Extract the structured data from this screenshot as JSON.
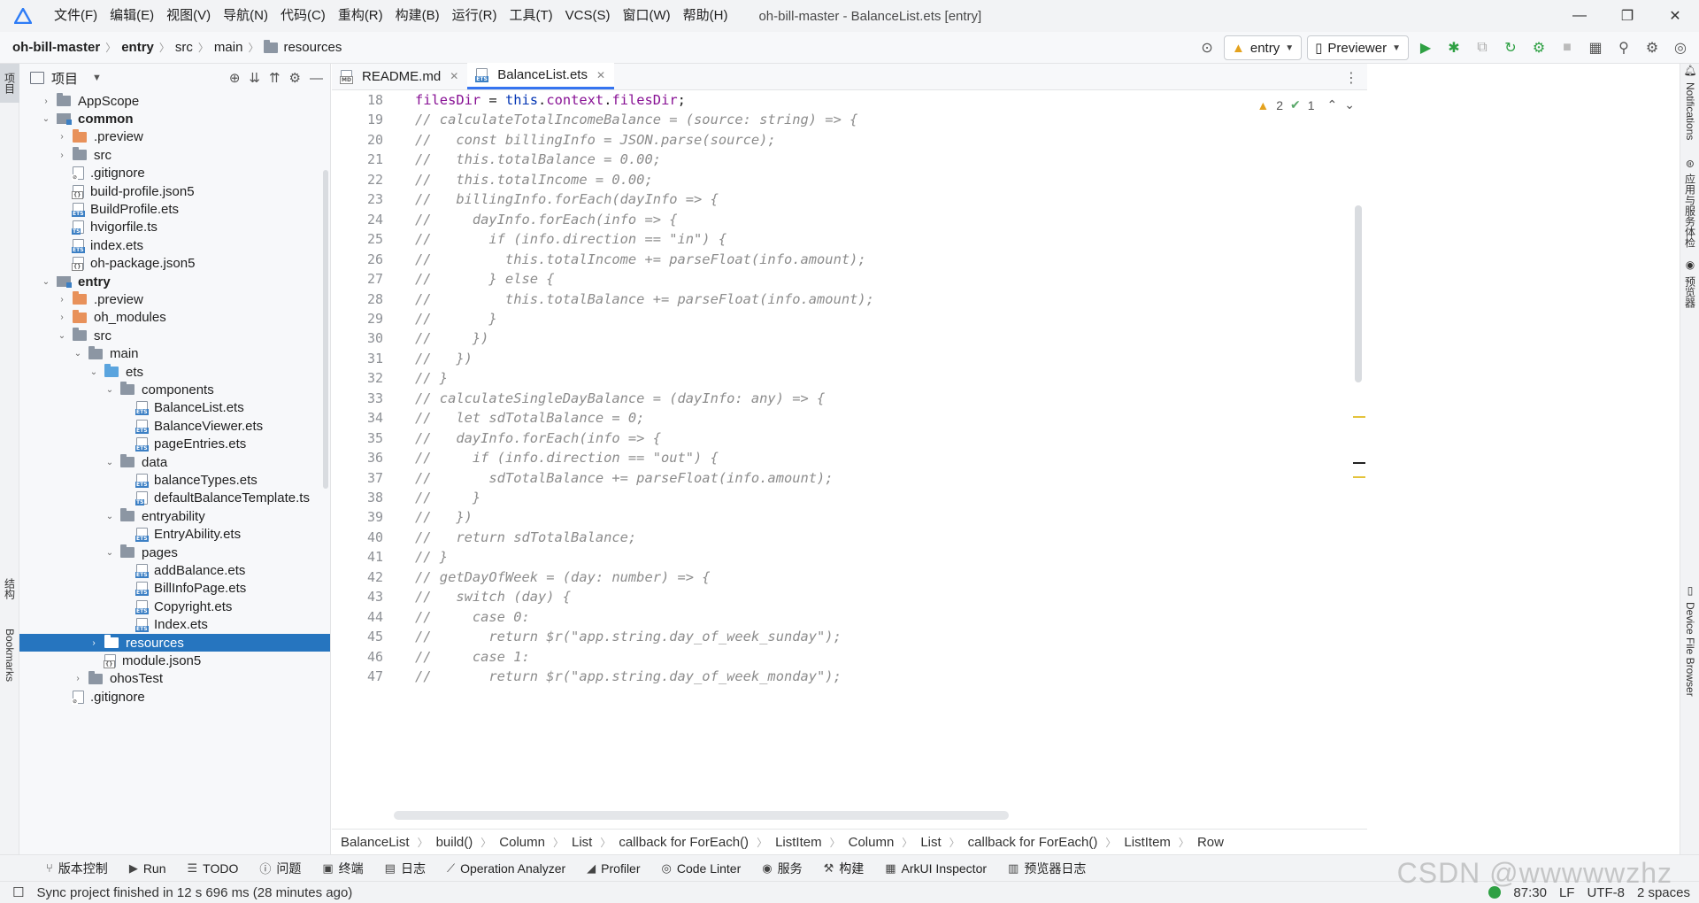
{
  "menubar": {
    "items": [
      "文件(F)",
      "编辑(E)",
      "视图(V)",
      "导航(N)",
      "代码(C)",
      "重构(R)",
      "构建(B)",
      "运行(R)",
      "工具(T)",
      "VCS(S)",
      "窗口(W)",
      "帮助(H)"
    ],
    "window_title": "oh-bill-master - BalanceList.ets [entry]"
  },
  "navbar": {
    "crumbs": [
      "oh-bill-master",
      "entry",
      "src",
      "main",
      "resources"
    ],
    "run_config": "entry",
    "device": "Previewer"
  },
  "left_stripe": {
    "project_tab": "项目",
    "structure_tab": "结构",
    "bookmarks_tab": "Bookmarks"
  },
  "project_panel": {
    "title": "项目",
    "tree": [
      {
        "label": "AppScope",
        "depth": 0,
        "arrow": "›",
        "icon": "folder",
        "bold": false
      },
      {
        "label": "common",
        "depth": 0,
        "arrow": "⌄",
        "icon": "module",
        "bold": true
      },
      {
        "label": ".preview",
        "depth": 1,
        "arrow": "›",
        "icon": "folder-orange",
        "bold": false
      },
      {
        "label": "src",
        "depth": 1,
        "arrow": "›",
        "icon": "folder",
        "bold": false
      },
      {
        "label": ".gitignore",
        "depth": 1,
        "arrow": "",
        "icon": "file-git",
        "bold": false
      },
      {
        "label": "build-profile.json5",
        "depth": 1,
        "arrow": "",
        "icon": "file-json",
        "bold": false
      },
      {
        "label": "BuildProfile.ets",
        "depth": 1,
        "arrow": "",
        "icon": "file-ets",
        "bold": false
      },
      {
        "label": "hvigorfile.ts",
        "depth": 1,
        "arrow": "",
        "icon": "file-ts",
        "bold": false
      },
      {
        "label": "index.ets",
        "depth": 1,
        "arrow": "",
        "icon": "file-ets",
        "bold": false
      },
      {
        "label": "oh-package.json5",
        "depth": 1,
        "arrow": "",
        "icon": "file-json",
        "bold": false
      },
      {
        "label": "entry",
        "depth": 0,
        "arrow": "⌄",
        "icon": "module",
        "bold": true
      },
      {
        "label": ".preview",
        "depth": 1,
        "arrow": "›",
        "icon": "folder-orange",
        "bold": false
      },
      {
        "label": "oh_modules",
        "depth": 1,
        "arrow": "›",
        "icon": "folder-orange",
        "bold": false
      },
      {
        "label": "src",
        "depth": 1,
        "arrow": "⌄",
        "icon": "folder",
        "bold": false
      },
      {
        "label": "main",
        "depth": 2,
        "arrow": "⌄",
        "icon": "folder",
        "bold": false
      },
      {
        "label": "ets",
        "depth": 3,
        "arrow": "⌄",
        "icon": "folder-blue",
        "bold": false
      },
      {
        "label": "components",
        "depth": 4,
        "arrow": "⌄",
        "icon": "folder",
        "bold": false
      },
      {
        "label": "BalanceList.ets",
        "depth": 5,
        "arrow": "",
        "icon": "file-ets",
        "bold": false
      },
      {
        "label": "BalanceViewer.ets",
        "depth": 5,
        "arrow": "",
        "icon": "file-ets",
        "bold": false
      },
      {
        "label": "pageEntries.ets",
        "depth": 5,
        "arrow": "",
        "icon": "file-ets",
        "bold": false
      },
      {
        "label": "data",
        "depth": 4,
        "arrow": "⌄",
        "icon": "folder",
        "bold": false
      },
      {
        "label": "balanceTypes.ets",
        "depth": 5,
        "arrow": "",
        "icon": "file-ets",
        "bold": false
      },
      {
        "label": "defaultBalanceTemplate.ts",
        "depth": 5,
        "arrow": "",
        "icon": "file-ts",
        "bold": false
      },
      {
        "label": "entryability",
        "depth": 4,
        "arrow": "⌄",
        "icon": "folder",
        "bold": false
      },
      {
        "label": "EntryAbility.ets",
        "depth": 5,
        "arrow": "",
        "icon": "file-ets",
        "bold": false
      },
      {
        "label": "pages",
        "depth": 4,
        "arrow": "⌄",
        "icon": "folder",
        "bold": false
      },
      {
        "label": "addBalance.ets",
        "depth": 5,
        "arrow": "",
        "icon": "file-ets",
        "bold": false
      },
      {
        "label": "BillInfoPage.ets",
        "depth": 5,
        "arrow": "",
        "icon": "file-ets",
        "bold": false
      },
      {
        "label": "Copyright.ets",
        "depth": 5,
        "arrow": "",
        "icon": "file-ets",
        "bold": false
      },
      {
        "label": "Index.ets",
        "depth": 5,
        "arrow": "",
        "icon": "file-ets",
        "bold": false
      },
      {
        "label": "resources",
        "depth": 3,
        "arrow": "›",
        "icon": "folder-white",
        "bold": false,
        "selected": true
      },
      {
        "label": "module.json5",
        "depth": 3,
        "arrow": "",
        "icon": "file-json",
        "bold": false
      },
      {
        "label": "ohosTest",
        "depth": 2,
        "arrow": "›",
        "icon": "folder",
        "bold": false
      },
      {
        "label": ".gitignore",
        "depth": 1,
        "arrow": "",
        "icon": "file-git",
        "bold": false
      }
    ]
  },
  "editor_tabs": [
    {
      "label": "README.md",
      "active": false
    },
    {
      "label": "BalanceList.ets",
      "active": true
    }
  ],
  "editor": {
    "warnings": "2",
    "checks": "1",
    "lines": [
      {
        "n": "18",
        "text": "filesDir = this.context.filesDir;",
        "comment": false
      },
      {
        "n": "19",
        "text": "// calculateTotalIncomeBalance = (source: string) => {",
        "comment": true
      },
      {
        "n": "20",
        "text": "//   const billingInfo = JSON.parse(source);",
        "comment": true
      },
      {
        "n": "21",
        "text": "//   this.totalBalance = 0.00;",
        "comment": true
      },
      {
        "n": "22",
        "text": "//   this.totalIncome = 0.00;",
        "comment": true
      },
      {
        "n": "23",
        "text": "//   billingInfo.forEach(dayInfo => {",
        "comment": true
      },
      {
        "n": "24",
        "text": "//     dayInfo.forEach(info => {",
        "comment": true
      },
      {
        "n": "25",
        "text": "//       if (info.direction == \"in\") {",
        "comment": true
      },
      {
        "n": "26",
        "text": "//         this.totalIncome += parseFloat(info.amount);",
        "comment": true
      },
      {
        "n": "27",
        "text": "//       } else {",
        "comment": true
      },
      {
        "n": "28",
        "text": "//         this.totalBalance += parseFloat(info.amount);",
        "comment": true
      },
      {
        "n": "29",
        "text": "//       }",
        "comment": true
      },
      {
        "n": "30",
        "text": "//     })",
        "comment": true
      },
      {
        "n": "31",
        "text": "//   })",
        "comment": true
      },
      {
        "n": "32",
        "text": "// }",
        "comment": true
      },
      {
        "n": "33",
        "text": "// calculateSingleDayBalance = (dayInfo: any) => {",
        "comment": true
      },
      {
        "n": "34",
        "text": "//   let sdTotalBalance = 0;",
        "comment": true
      },
      {
        "n": "35",
        "text": "//   dayInfo.forEach(info => {",
        "comment": true
      },
      {
        "n": "36",
        "text": "//     if (info.direction == \"out\") {",
        "comment": true
      },
      {
        "n": "37",
        "text": "//       sdTotalBalance += parseFloat(info.amount);",
        "comment": true
      },
      {
        "n": "38",
        "text": "//     }",
        "comment": true
      },
      {
        "n": "39",
        "text": "//   })",
        "comment": true
      },
      {
        "n": "40",
        "text": "//   return sdTotalBalance;",
        "comment": true
      },
      {
        "n": "41",
        "text": "// }",
        "comment": true
      },
      {
        "n": "42",
        "text": "// getDayOfWeek = (day: number) => {",
        "comment": true
      },
      {
        "n": "43",
        "text": "//   switch (day) {",
        "comment": true
      },
      {
        "n": "44",
        "text": "//     case 0:",
        "comment": true
      },
      {
        "n": "45",
        "text": "//       return $r(\"app.string.day_of_week_sunday\");",
        "comment": true
      },
      {
        "n": "46",
        "text": "//     case 1:",
        "comment": true
      },
      {
        "n": "47",
        "text": "//       return $r(\"app.string.day_of_week_monday\");",
        "comment": true
      }
    ]
  },
  "editor_crumbs": [
    "BalanceList",
    "build()",
    "Column",
    "List",
    "callback for ForEach()",
    "ListItem",
    "Column",
    "List",
    "callback for ForEach()",
    "ListItem",
    "Row"
  ],
  "right_stripe": {
    "notifications": "Notifications",
    "service_tab": "应用与服务体检",
    "previewer_tab": "预览器",
    "device_file": "Device File Browser"
  },
  "tool_windows": [
    {
      "label": "版本控制",
      "icon": "branch-icon"
    },
    {
      "label": "Run",
      "icon": "play-icon"
    },
    {
      "label": "TODO",
      "icon": "list-icon"
    },
    {
      "label": "问题",
      "icon": "info-icon"
    },
    {
      "label": "终端",
      "icon": "terminal-icon"
    },
    {
      "label": "日志",
      "icon": "log-icon"
    },
    {
      "label": "Operation Analyzer",
      "icon": "chart-icon"
    },
    {
      "label": "Profiler",
      "icon": "profiler-icon"
    },
    {
      "label": "Code Linter",
      "icon": "linter-icon"
    },
    {
      "label": "服务",
      "icon": "service-icon"
    },
    {
      "label": "构建",
      "icon": "hammer-icon"
    },
    {
      "label": "ArkUI Inspector",
      "icon": "inspector-icon"
    },
    {
      "label": "预览器日志",
      "icon": "preview-log-icon"
    }
  ],
  "statusbar": {
    "message": "Sync project finished in 12 s 696 ms (28 minutes ago)",
    "position": "87:30",
    "line_sep": "LF",
    "encoding": "UTF-8",
    "indent": "2 spaces"
  },
  "watermark": "CSDN @wwwwwzhz"
}
